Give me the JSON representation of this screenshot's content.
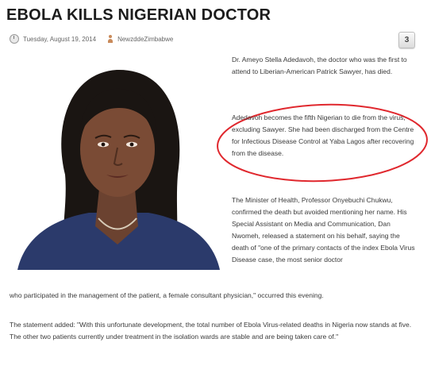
{
  "article": {
    "headline": "EBOLA KILLS NIGERIAN DOCTOR",
    "date": "Tuesday, August 19, 2014",
    "author": "NewzddeZimbabwe",
    "comment_count": "3",
    "paragraphs": [
      "Dr. Ameyo Stella Adedavoh, the doctor who was the first to attend to Liberian-American Patrick Sawyer, has died.",
      "Adedavoh becomes the fifth Nigerian to die from the virus, excluding Sawyer. She had been discharged from the Centre for Infectious Disease Control at Yaba Lagos after recovering from the disease.",
      "The Minister of Health, Professor Onyebuchi Chukwu, confirmed the death but avoided mentioning her name. His Special Assistant on Media and Communication, Dan Nwomeh, released a statement on his behalf, saying the death of \"one of the primary contacts of the index Ebola Virus Disease case, the most senior doctor",
      "who participated in the management of the patient, a female consultant physician,\" occurred this evening.",
      "The statement added: \"With this unfortunate development, the total number of Ebola Virus-related deaths in Nigeria now stands at five. The other two patients currently under treatment in the isolation wards are stable and are being taken care of.\""
    ]
  },
  "colors": {
    "headline": "#1c1c1c",
    "body_text": "#3a3a3a",
    "annotation_circle": "#e0282e",
    "jacket": "#2b3a6b"
  },
  "icons": {
    "date": "clock-icon",
    "author": "person-icon",
    "comments": "comment-bubble-icon"
  }
}
